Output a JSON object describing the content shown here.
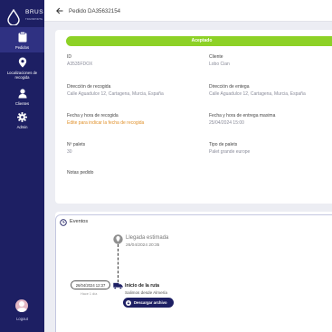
{
  "sidebar": {
    "brand": "BRUS",
    "brand_sub": "TRANSPORTE",
    "items": [
      {
        "label": "Pedidos",
        "icon": "clipboard-icon"
      },
      {
        "label": "Localizaciones de recogida",
        "icon": "location-pin-icon"
      },
      {
        "label": "Clientes",
        "icon": "user-icon"
      },
      {
        "label": "Admin",
        "icon": "gear-icon"
      }
    ],
    "logout": "Logout"
  },
  "header": {
    "title": "Pedido DA35632154"
  },
  "order": {
    "status": "Aceptado",
    "status_color": "#8dd126",
    "fields": {
      "id": {
        "label": "ID",
        "value": "A3535FDOX"
      },
      "client": {
        "label": "Cliente",
        "value": "Lobo Cian"
      },
      "pickup_address": {
        "label": "Dirección de recogida",
        "value": "Calle Aguadulce 12, Cartagena, Murcia, España"
      },
      "delivery_address": {
        "label": "Dirección de entega",
        "value": "Calle Aguadulce 12, Cartagena, Murcia, España"
      },
      "pickup_datetime": {
        "label": "Fecha y hora de recogida",
        "value": "Edite para indicar la fecha de recogida"
      },
      "delivery_datetime": {
        "label": "Fecha y hora de entrega maxima",
        "value": "25/04/2024 15:00"
      },
      "pallets": {
        "label": "Nº palets",
        "value": "30"
      },
      "pallet_type": {
        "label": "Tipo de palets",
        "value": "Palet grande europe"
      },
      "notes": {
        "label": "Notas pedido",
        "value": ""
      }
    }
  },
  "events": {
    "title": "Eventos",
    "items": [
      {
        "title": "Llegada estimada",
        "subtitle": "26/04/2024 20:35"
      },
      {
        "title": "Inicio de la ruta",
        "subtitle": "Salimos desde Almería",
        "date": "26/04/2024 12:37",
        "ago": "Hace 1 día",
        "button": "Descargar archivo"
      }
    ]
  },
  "colors": {
    "sidebar": "#1d1f63",
    "accent": "#8dd126",
    "warning": "#e0902a"
  }
}
